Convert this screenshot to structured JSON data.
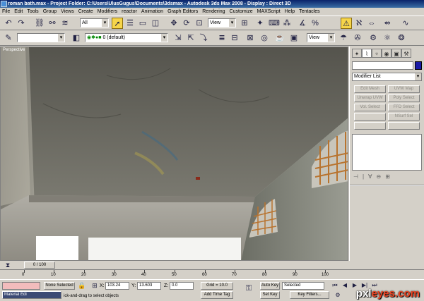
{
  "titlebar": {
    "text": "roman bath.max    - Project Folder: C:\\Users\\UlusGugus\\Documents\\3dsmax    - Autodesk 3ds Max 2008    - Display : Direct 3D"
  },
  "menu": [
    "File",
    "Edit",
    "Tools",
    "Group",
    "Views",
    "Create",
    "Modifiers",
    "reactor",
    "Animation",
    "Graph Editors",
    "Rendering",
    "Customize",
    "MAXScript",
    "Help",
    "Tentacles"
  ],
  "toolbar": {
    "selection_filter": "All",
    "ref_coord": "View",
    "layer": "0 (default)",
    "ref_coord2": "View"
  },
  "viewport": {
    "label": "Perspective"
  },
  "command_panel": {
    "modifier_list": "Modifier List",
    "buttons": [
      "Edit Mesh",
      "UVW Map",
      "Unwrap UVW",
      "Poly Select",
      "Vol. Select",
      "FFD Select",
      "",
      "NSurf Sel",
      "",
      ""
    ]
  },
  "timeline": {
    "frame": "0 / 100",
    "ticks": [
      "0",
      "10",
      "20",
      "30",
      "40",
      "50",
      "60",
      "70",
      "80",
      "90",
      "100"
    ]
  },
  "status": {
    "selection": "None Selected",
    "x_label": "X:",
    "x": "103.24",
    "y_label": "Y:",
    "y": "13.603",
    "z_label": "Z:",
    "z": "0.0",
    "grid": "Grid = 10.0",
    "auto_key": "Auto Key",
    "key_mode": "Selected",
    "set_key": "Set Key",
    "key_filters": "Key Filters...",
    "add_time_tag": "Add Time Tag",
    "prompt": "ick-and-drag to select objects",
    "material_editor_tab": "Material Edi"
  },
  "watermark": {
    "prefix": "pxl",
    "suffix": "eyes.com"
  }
}
